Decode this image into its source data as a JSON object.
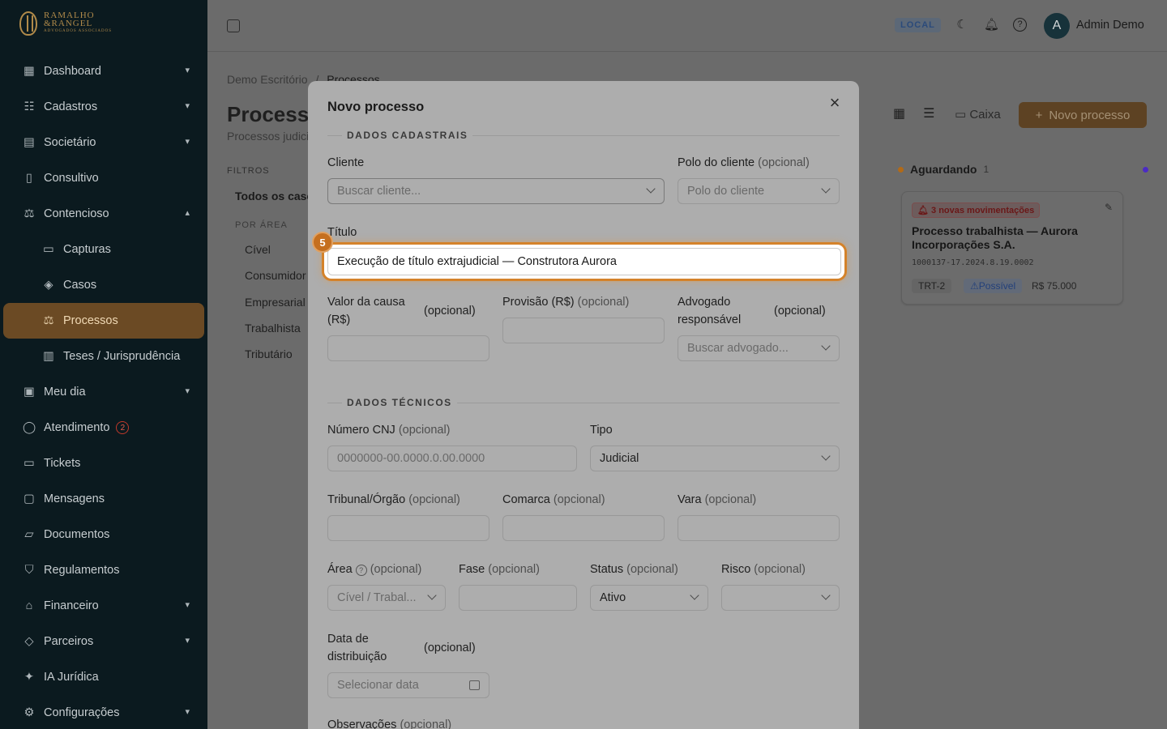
{
  "brand": {
    "name_line1": "RAMALHO",
    "name_line2": "&RANGEL",
    "tagline": "ADVOGADOS ASSOCIADOS"
  },
  "sidebar": {
    "items": [
      {
        "label": "Dashboard",
        "icon": "dashboard-icon"
      },
      {
        "label": "Cadastros",
        "icon": "users-icon"
      },
      {
        "label": "Societário",
        "icon": "building-icon"
      },
      {
        "label": "Consultivo",
        "icon": "book-icon"
      },
      {
        "label": "Contencioso",
        "icon": "scale-icon"
      },
      {
        "label": "Capturas",
        "icon": "inbox-icon"
      },
      {
        "label": "Casos",
        "icon": "layers-icon"
      },
      {
        "label": "Processos",
        "icon": "scale-icon"
      },
      {
        "label": "Teses / Jurisprudência",
        "icon": "notebook-icon"
      },
      {
        "label": "Meu dia",
        "icon": "calendar-icon"
      },
      {
        "label": "Atendimento",
        "icon": "chat-icon",
        "badge": "2"
      },
      {
        "label": "Tickets",
        "icon": "ticket-icon"
      },
      {
        "label": "Mensagens",
        "icon": "message-icon"
      },
      {
        "label": "Documentos",
        "icon": "folder-icon"
      },
      {
        "label": "Regulamentos",
        "icon": "shield-icon"
      },
      {
        "label": "Financeiro",
        "icon": "bank-icon"
      },
      {
        "label": "Parceiros",
        "icon": "handshake-icon"
      },
      {
        "label": "IA Jurídica",
        "icon": "sparkle-icon"
      },
      {
        "label": "Configurações",
        "icon": "gear-icon"
      }
    ]
  },
  "topbar": {
    "env": "LOCAL",
    "user_initial": "A",
    "user_name": "Admin Demo"
  },
  "page": {
    "breadcrumb_root": "Demo Escritório",
    "breadcrumb_sep": "/",
    "breadcrumb_current": "Processos",
    "title": "Processos",
    "subtitle": "Processos judiciais",
    "filters_heading": "FILTROS",
    "filter_all": "Todos os casos",
    "area_heading": "POR ÁREA",
    "areas": [
      "Cível",
      "Consumidor",
      "Empresarial",
      "Trabalhista",
      "Tributário"
    ],
    "caixa_label": "Caixa",
    "new_button": "Novo processo"
  },
  "board": {
    "column_title": "Aguardando",
    "column_count": "1",
    "card": {
      "badge": "3 novas movimentações",
      "title": "Processo trabalhista — Aurora Incorporações S.A.",
      "number": "1000137-17.2024.8.19.0002",
      "court": "TRT-2",
      "risk": "Possível",
      "value": "R$ 75.000"
    }
  },
  "modal": {
    "title": "Novo processo",
    "section1": "DADOS CADASTRAIS",
    "section2": "DADOS TÉCNICOS",
    "optional": "(opcional)",
    "cliente_label": "Cliente",
    "cliente_placeholder": "Buscar cliente...",
    "polo_label": "Polo do cliente",
    "polo_placeholder": "Polo do cliente",
    "titulo_label": "Título",
    "titulo_value": "Execução de título extrajudicial — Construtora Aurora",
    "step": "5",
    "valor_label": "Valor da causa (R$)",
    "provisao_label": "Provisão (R$)",
    "advogado_label": "Advogado responsável",
    "advogado_placeholder": "Buscar advogado...",
    "cnj_label": "Número CNJ",
    "cnj_placeholder": "0000000-00.0000.0.00.0000",
    "tipo_label": "Tipo",
    "tipo_value": "Judicial",
    "tribunal_label": "Tribunal/Órgão",
    "comarca_label": "Comarca",
    "vara_label": "Vara",
    "area_label": "Área",
    "area_placeholder": "Cível / Trabal...",
    "fase_label": "Fase",
    "status_label": "Status",
    "status_value": "Ativo",
    "risco_label": "Risco",
    "data_label": "Data de distribuição",
    "data_placeholder": "Selecionar data",
    "obs_label": "Observações"
  },
  "colors": {
    "sidebar_bg": "#0b1a1f",
    "active_item": "#6b4a24",
    "accent": "#c56f1f",
    "focus_ring": "#d4822a"
  }
}
